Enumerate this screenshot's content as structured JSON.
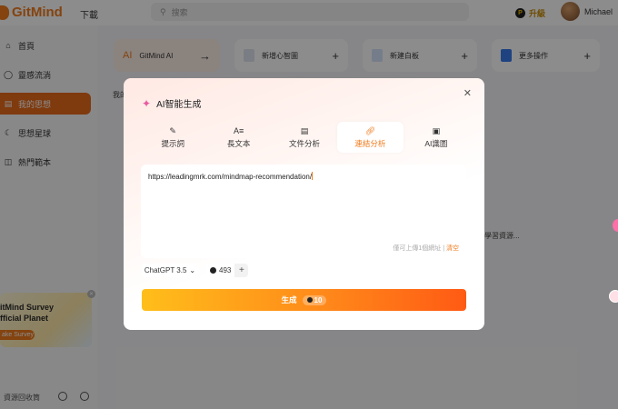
{
  "app": {
    "brand": "GitMind",
    "download": "下載",
    "search_placeholder": "搜索",
    "upgrade": "升級",
    "user_name": "Michael"
  },
  "sidebar": {
    "items": [
      {
        "label": "首頁"
      },
      {
        "label": "靈感流淌"
      },
      {
        "label": "我的思想"
      },
      {
        "label": "思想星球"
      },
      {
        "label": "熱門範本"
      }
    ],
    "promo": {
      "line1": "itMind Survey",
      "line2": "fficial Planet",
      "button": "ake Survey"
    },
    "trash": "資源回收筒"
  },
  "quick_actions": [
    {
      "label": "GitMind AI",
      "badge": "AI"
    },
    {
      "label": "新增心智圖"
    },
    {
      "label": "新建白板"
    },
    {
      "label": "更多操作"
    }
  ],
  "background": {
    "section_prefix": "我的",
    "file_fragment": "學習資源..."
  },
  "modal": {
    "title": "AI智能生成",
    "tabs": [
      {
        "label": "提示詞",
        "icon": "pen-icon"
      },
      {
        "label": "長文本",
        "icon": "text-icon"
      },
      {
        "label": "文件分析",
        "icon": "file-icon"
      },
      {
        "label": "連結分析",
        "icon": "link-icon"
      },
      {
        "label": "AI識圖",
        "icon": "image-icon"
      }
    ],
    "active_tab": "連結分析",
    "input_value": "https://leadingmrk.com/mindmap-recommendation/",
    "hint": "僅可上傳1個網址 |",
    "clear": "清空",
    "model": "ChatGPT 3.5",
    "credits": "493",
    "generate_label": "生成",
    "generate_cost": "10"
  },
  "colors": {
    "accent": "#f07b1d",
    "active_nav": "#e86a1a"
  }
}
